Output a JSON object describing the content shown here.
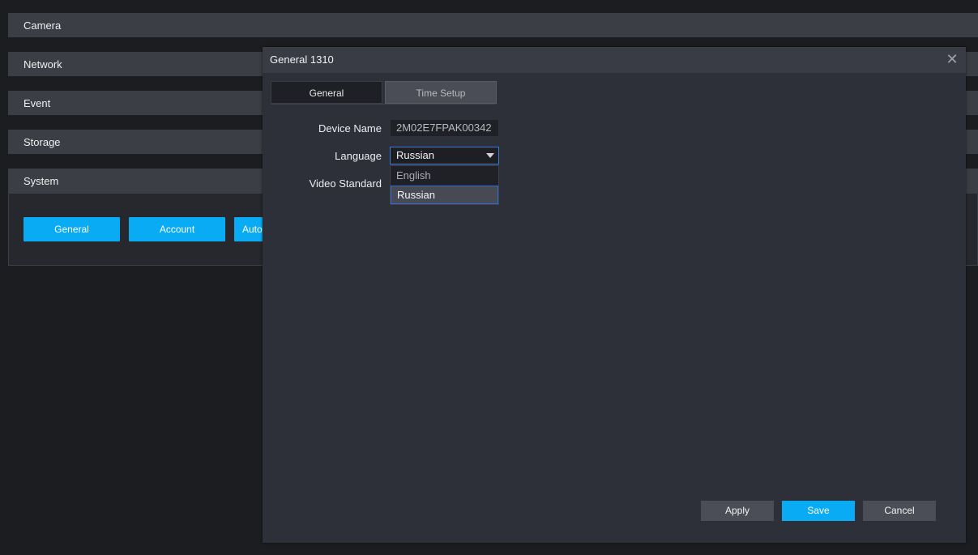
{
  "sections": [
    {
      "label": "Camera"
    },
    {
      "label": "Network"
    },
    {
      "label": "Event"
    },
    {
      "label": "Storage"
    },
    {
      "label": "System"
    }
  ],
  "system_buttons": [
    {
      "label": "General"
    },
    {
      "label": "Account"
    },
    {
      "label": "Auto"
    }
  ],
  "dialog": {
    "title": "General 1310",
    "close_icon": "close-icon",
    "tabs": [
      {
        "label": "General",
        "active": true
      },
      {
        "label": "Time Setup",
        "active": false
      }
    ],
    "form": {
      "device_name_label": "Device Name",
      "device_name_value": "2M02E7FPAK00342",
      "language_label": "Language",
      "language_value": "Russian",
      "language_options": [
        "English",
        "Russian"
      ],
      "video_standard_label": "Video Standard"
    },
    "buttons": {
      "apply": "Apply",
      "save": "Save",
      "cancel": "Cancel"
    }
  },
  "colors": {
    "accent": "#0aabf5",
    "background": "#1c1d20",
    "dialog": "#2d3039",
    "section_bar": "#3b3e45"
  }
}
